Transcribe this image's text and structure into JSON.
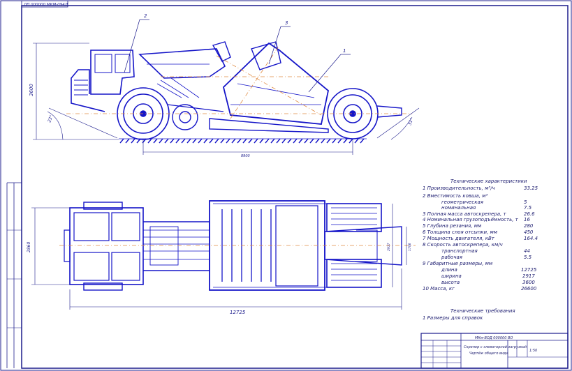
{
  "sheet": {
    "stamp": "ДП 000000 МКМ-094Д",
    "title_block_code": "МКм-ВОД 000000 ВО",
    "drawing_title": "Скрепер с элеваторной загрузкой",
    "drawing_subtitle": "Чертёж общего вида",
    "scale": "1:50"
  },
  "callouts": [
    "1",
    "2",
    "3"
  ],
  "dimensions": {
    "side_height": "3600",
    "side_wheelbase": "8900",
    "side_angle_front": "23°",
    "side_angle_rear": "31°",
    "top_width": "2860",
    "top_length": "12725",
    "top_bowl_width": "2917",
    "top_inner": "1706"
  },
  "specs": {
    "heading": "Технические характеристики",
    "rows": [
      {
        "label": "1 Производительность, м³/ч",
        "value": "33.25"
      },
      {
        "label": "2 Вместимость ковша, м³",
        "value": ""
      },
      {
        "label": "геометрическая",
        "value": "5"
      },
      {
        "label": "номинальная",
        "value": "7.5"
      },
      {
        "label": "3 Полная масса автоскрепера, т",
        "value": "26.6"
      },
      {
        "label": "4 Номинальная грузоподъёмность, т",
        "value": "16"
      },
      {
        "label": "5 Глубина резания, мм",
        "value": "280"
      },
      {
        "label": "6 Толщина слоя отсыпки, мм",
        "value": "450"
      },
      {
        "label": "7 Мощность двигателя, кВт",
        "value": "164.4"
      },
      {
        "label": "8 Скорость автоскрепера, км/ч",
        "value": ""
      },
      {
        "label": "транспортная",
        "value": "44"
      },
      {
        "label": "рабочая",
        "value": "5.5"
      },
      {
        "label": "9 Габаритные размеры, мм",
        "value": ""
      },
      {
        "label": "длина",
        "value": "12725"
      },
      {
        "label": "ширина",
        "value": "2917"
      },
      {
        "label": "высота",
        "value": "3600"
      },
      {
        "label": "10 Масса, кг",
        "value": "26600"
      }
    ]
  },
  "requirements": {
    "heading": "Технические требования",
    "items": [
      "1 Размеры для справок"
    ]
  },
  "colors": {
    "frame": "#1c1c8c",
    "lines": "#1515c8",
    "centerline": "#e08a40",
    "hatch": "#3a3a9a"
  }
}
